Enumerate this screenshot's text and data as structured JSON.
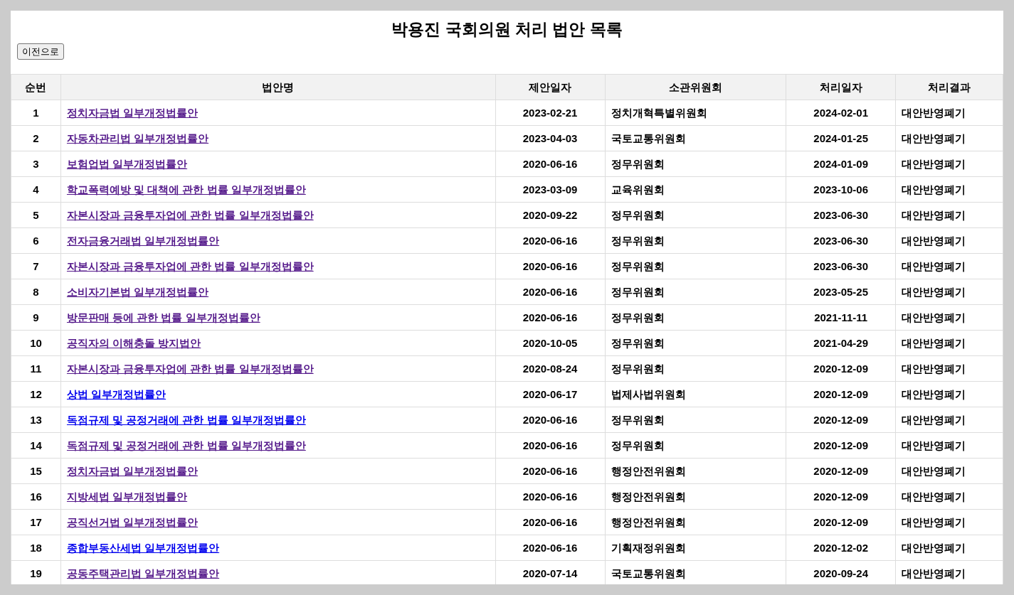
{
  "title": "박용진 국회의원 처리 법안 목록",
  "back_button": "이전으로",
  "table": {
    "columns": [
      "순번",
      "법안명",
      "제안일자",
      "소관위원회",
      "처리일자",
      "처리결과"
    ],
    "rows": [
      {
        "no": "1",
        "bill": "정치자금법 일부개정법률안",
        "visited": true,
        "proposed": "2023-02-21",
        "committee": "정치개혁특별위원회",
        "processed": "2024-02-01",
        "result": "대안반영폐기"
      },
      {
        "no": "2",
        "bill": "자동차관리법 일부개정법률안",
        "visited": true,
        "proposed": "2023-04-03",
        "committee": "국토교통위원회",
        "processed": "2024-01-25",
        "result": "대안반영폐기"
      },
      {
        "no": "3",
        "bill": "보험업법 일부개정법률안",
        "visited": true,
        "proposed": "2020-06-16",
        "committee": "정무위원회",
        "processed": "2024-01-09",
        "result": "대안반영폐기"
      },
      {
        "no": "4",
        "bill": "학교폭력예방 및 대책에 관한 법률 일부개정법률안",
        "visited": true,
        "proposed": "2023-03-09",
        "committee": "교육위원회",
        "processed": "2023-10-06",
        "result": "대안반영폐기"
      },
      {
        "no": "5",
        "bill": "자본시장과 금융투자업에 관한 법률 일부개정법률안",
        "visited": true,
        "proposed": "2020-09-22",
        "committee": "정무위원회",
        "processed": "2023-06-30",
        "result": "대안반영폐기"
      },
      {
        "no": "6",
        "bill": "전자금융거래법 일부개정법률안",
        "visited": true,
        "proposed": "2020-06-16",
        "committee": "정무위원회",
        "processed": "2023-06-30",
        "result": "대안반영폐기"
      },
      {
        "no": "7",
        "bill": "자본시장과 금융투자업에 관한 법률 일부개정법률안",
        "visited": true,
        "proposed": "2020-06-16",
        "committee": "정무위원회",
        "processed": "2023-06-30",
        "result": "대안반영폐기"
      },
      {
        "no": "8",
        "bill": "소비자기본법 일부개정법률안",
        "visited": true,
        "proposed": "2020-06-16",
        "committee": "정무위원회",
        "processed": "2023-05-25",
        "result": "대안반영폐기"
      },
      {
        "no": "9",
        "bill": "방문판매 등에 관한 법률 일부개정법률안",
        "visited": true,
        "proposed": "2020-06-16",
        "committee": "정무위원회",
        "processed": "2021-11-11",
        "result": "대안반영폐기"
      },
      {
        "no": "10",
        "bill": "공직자의 이해충돌 방지법안",
        "visited": true,
        "proposed": "2020-10-05",
        "committee": "정무위원회",
        "processed": "2021-04-29",
        "result": "대안반영폐기"
      },
      {
        "no": "11",
        "bill": "자본시장과 금융투자업에 관한 법률 일부개정법률안",
        "visited": true,
        "proposed": "2020-08-24",
        "committee": "정무위원회",
        "processed": "2020-12-09",
        "result": "대안반영폐기"
      },
      {
        "no": "12",
        "bill": "상법 일부개정법률안",
        "visited": false,
        "proposed": "2020-06-17",
        "committee": "법제사법위원회",
        "processed": "2020-12-09",
        "result": "대안반영폐기"
      },
      {
        "no": "13",
        "bill": "독점규제 및 공정거래에 관한 법률 일부개정법률안",
        "visited": false,
        "proposed": "2020-06-16",
        "committee": "정무위원회",
        "processed": "2020-12-09",
        "result": "대안반영폐기"
      },
      {
        "no": "14",
        "bill": "독점규제 및 공정거래에 관한 법률 일부개정법률안",
        "visited": true,
        "proposed": "2020-06-16",
        "committee": "정무위원회",
        "processed": "2020-12-09",
        "result": "대안반영폐기"
      },
      {
        "no": "15",
        "bill": "정치자금법 일부개정법률안",
        "visited": true,
        "proposed": "2020-06-16",
        "committee": "행정안전위원회",
        "processed": "2020-12-09",
        "result": "대안반영폐기"
      },
      {
        "no": "16",
        "bill": "지방세법 일부개정법률안",
        "visited": true,
        "proposed": "2020-06-16",
        "committee": "행정안전위원회",
        "processed": "2020-12-09",
        "result": "대안반영폐기"
      },
      {
        "no": "17",
        "bill": "공직선거법 일부개정법률안",
        "visited": true,
        "proposed": "2020-06-16",
        "committee": "행정안전위원회",
        "processed": "2020-12-09",
        "result": "대안반영폐기"
      },
      {
        "no": "18",
        "bill": "종합부동산세법 일부개정법률안",
        "visited": false,
        "proposed": "2020-06-16",
        "committee": "기획재정위원회",
        "processed": "2020-12-02",
        "result": "대안반영폐기"
      },
      {
        "no": "19",
        "bill": "공동주택관리법 일부개정법률안",
        "visited": true,
        "proposed": "2020-07-14",
        "committee": "국토교통위원회",
        "processed": "2020-09-24",
        "result": "대안반영폐기"
      }
    ]
  }
}
